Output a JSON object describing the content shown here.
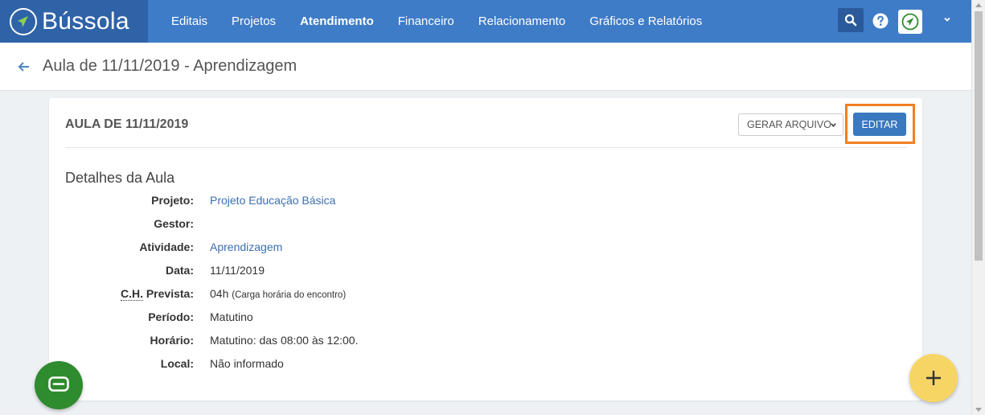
{
  "brand": {
    "name": "Bússola"
  },
  "nav": {
    "items": [
      {
        "label": "Editais"
      },
      {
        "label": "Projetos"
      },
      {
        "label": "Atendimento"
      },
      {
        "label": "Financeiro"
      },
      {
        "label": "Relacionamento"
      },
      {
        "label": "Gráficos e Relatórios"
      }
    ],
    "active_index": 2
  },
  "header": {
    "title": "Aula de 11/11/2019 - Aprendizagem"
  },
  "card": {
    "title": "AULA DE 11/11/2019",
    "gerar_label": "GERAR ARQUIVO",
    "editar_label": "EDITAR",
    "section_title": "Detalhes da Aula",
    "details": [
      {
        "label": "Projeto:",
        "value": "Projeto Educação Básica",
        "link": true
      },
      {
        "label": "Gestor:",
        "value": "",
        "link": false
      },
      {
        "label": "Atividade:",
        "value": "Aprendizagem",
        "link": true
      },
      {
        "label": "Data:",
        "value": "11/11/2019",
        "link": false
      },
      {
        "label_abbr": "C.H.",
        "label": " Prevista:",
        "value": "04h",
        "value_note": "(Carga horária do encontro)",
        "link": false
      },
      {
        "label": "Período:",
        "value": "Matutino",
        "link": false
      },
      {
        "label": "Horário:",
        "value": "Matutino: das 08:00 às 12:00.",
        "link": false
      },
      {
        "label": "Local:",
        "value": "Não informado",
        "link": false
      }
    ]
  },
  "colors": {
    "nav_bg": "#3f7cc7",
    "brand_bg": "#2f63a8",
    "primary_button": "#3a78bf",
    "highlight": "#f07f22",
    "chat_fab": "#2e8b2e",
    "add_fab": "#f7d565",
    "link": "#3a6fb0"
  },
  "icons": {
    "brand": "compass-icon",
    "search": "search-icon",
    "help": "help-icon",
    "avatar": "compass-avatar-icon",
    "back": "arrow-left-icon",
    "chat": "chat-icon",
    "add": "plus-icon"
  }
}
